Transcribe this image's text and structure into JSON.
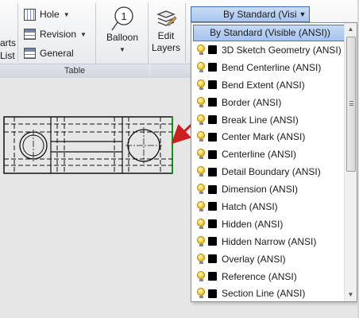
{
  "ribbon": {
    "parts_list": {
      "line1": "arts",
      "line2": "List"
    },
    "commands": {
      "hole": "Hole",
      "revision": "Revision",
      "general": "General"
    },
    "balloon": {
      "label": "Balloon",
      "number": "1"
    },
    "edit_layers": {
      "line1": "Edit",
      "line2": "Layers"
    },
    "table_panel_title": "Table"
  },
  "style_select": {
    "value": "By Standard (Visi",
    "accent": "#a9c6ee"
  },
  "layer_dropdown": {
    "selected": "By Standard (Visible (ANSI))",
    "items": [
      "3D Sketch Geometry (ANSI)",
      "Bend Centerline (ANSI)",
      "Bend Extent (ANSI)",
      "Border (ANSI)",
      "Break Line (ANSI)",
      "Center Mark (ANSI)",
      "Centerline (ANSI)",
      "Detail Boundary (ANSI)",
      "Dimension (ANSI)",
      "Hatch (ANSI)",
      "Hidden (ANSI)",
      "Hidden Narrow (ANSI)",
      "Overlay (ANSI)",
      "Reference (ANSI)",
      "Section Line (ANSI)"
    ],
    "icons": {
      "visibility": "lightbulb-icon",
      "color": "color-swatch-icon"
    },
    "swatch_color": "#000000",
    "highlight_color": "#c6dbf6"
  },
  "annotation": {
    "arrow_color": "#cc1f1f"
  },
  "drawing": {
    "selection_edge_color": "#1a8f1a"
  }
}
